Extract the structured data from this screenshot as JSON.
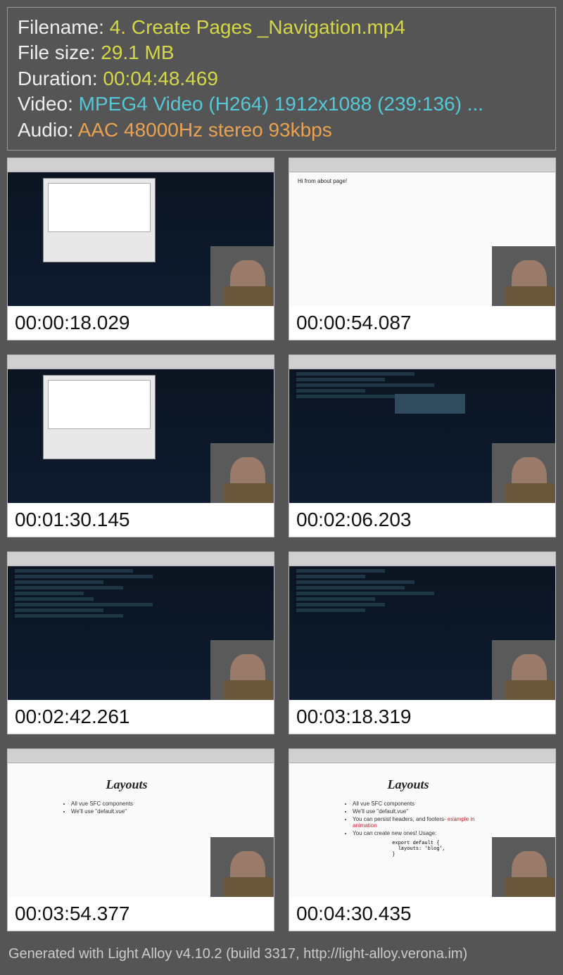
{
  "info": {
    "filename_label": "Filename: ",
    "filename": "4. Create Pages _Navigation.mp4",
    "filesize_label": "File size: ",
    "filesize": "29.1 MB",
    "duration_label": "Duration: ",
    "duration": "00:04:48.469",
    "video_label": "Video: ",
    "video": "MPEG4 Video (H264) 1912x1088 (239:136) ...",
    "audio_label": "Audio: ",
    "audio": "AAC 48000Hz stereo 93kbps"
  },
  "thumbs": [
    {
      "ts": "00:00:18.029",
      "kind": "editor-dialog"
    },
    {
      "ts": "00:00:54.087",
      "kind": "browser",
      "text": "Hi from about page!"
    },
    {
      "ts": "00:01:30.145",
      "kind": "editor-dialog"
    },
    {
      "ts": "00:02:06.203",
      "kind": "editor-hint"
    },
    {
      "ts": "00:02:42.261",
      "kind": "editor-code"
    },
    {
      "ts": "00:03:18.319",
      "kind": "editor-code"
    },
    {
      "ts": "00:03:54.377",
      "kind": "slide1",
      "title": "Layouts",
      "bullets": [
        "All vue SFC components",
        "We'll use \"default.vue\""
      ]
    },
    {
      "ts": "00:04:30.435",
      "kind": "slide2",
      "title": "Layouts",
      "bullets": [
        "All vue SFC components",
        "We'll use \"default.vue\"",
        "You can persist headers, and footers- ",
        "You can create new ones! Usage:"
      ],
      "red": "example in animation",
      "code": "export default {\n  layouts: 'blog',\n}"
    }
  ],
  "footer": "Generated with Light Alloy v4.10.2 (build 3317, http://light-alloy.verona.im)"
}
